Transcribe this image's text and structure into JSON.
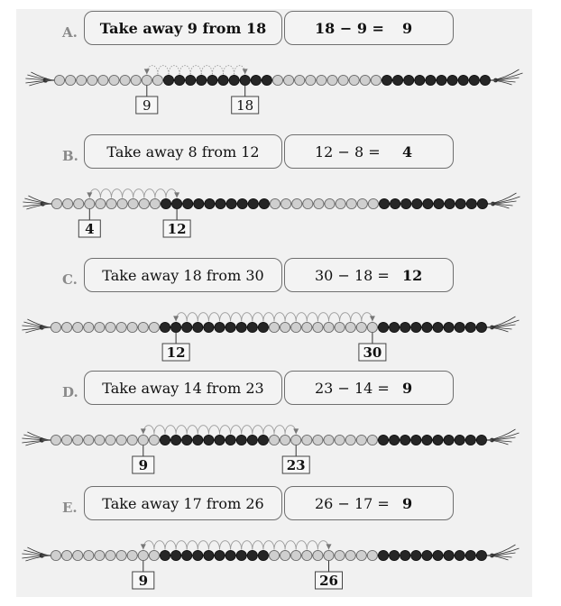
{
  "bead_string": {
    "total_beads": 40,
    "pattern": [
      {
        "color": "light",
        "count": 10
      },
      {
        "color": "dark",
        "count": 10
      },
      {
        "color": "light",
        "count": 10
      },
      {
        "color": "dark",
        "count": 10
      }
    ],
    "colors": {
      "light": "#cfcfcf",
      "dark": "#262626",
      "string": "#555555",
      "arc": "#9a9a9a",
      "box_border": "#444444"
    }
  },
  "problems": [
    {
      "letter": "A.",
      "question": "Take away 9 from 18",
      "equation": "18 − 9 =",
      "answer": "9",
      "start": 18,
      "take_away": 9,
      "result": 9,
      "start_label": "18",
      "result_label": "9",
      "emphasis": "bold"
    },
    {
      "letter": "B.",
      "question": "Take away 8 from 12",
      "equation": "12 − 8 =",
      "answer": "4",
      "start": 12,
      "take_away": 8,
      "result": 4,
      "start_label": "12",
      "result_label": "4",
      "emphasis": "normal"
    },
    {
      "letter": "C.",
      "question": "Take away 18 from 30",
      "equation": "30 − 18 =",
      "answer": "12",
      "start": 30,
      "take_away": 18,
      "result": 12,
      "start_label": "30",
      "result_label": "12",
      "emphasis": "normal"
    },
    {
      "letter": "D.",
      "question": "Take away 14 from 23",
      "equation": "23 − 14 =",
      "answer": "9",
      "start": 23,
      "take_away": 14,
      "result": 9,
      "start_label": "23",
      "result_label": "9",
      "emphasis": "normal"
    },
    {
      "letter": "E.",
      "question": "Take away 17 from 26",
      "equation": "26 − 17 =",
      "answer": "9",
      "start": 26,
      "take_away": 17,
      "result": 9,
      "start_label": "26",
      "result_label": "9",
      "emphasis": "normal"
    }
  ]
}
